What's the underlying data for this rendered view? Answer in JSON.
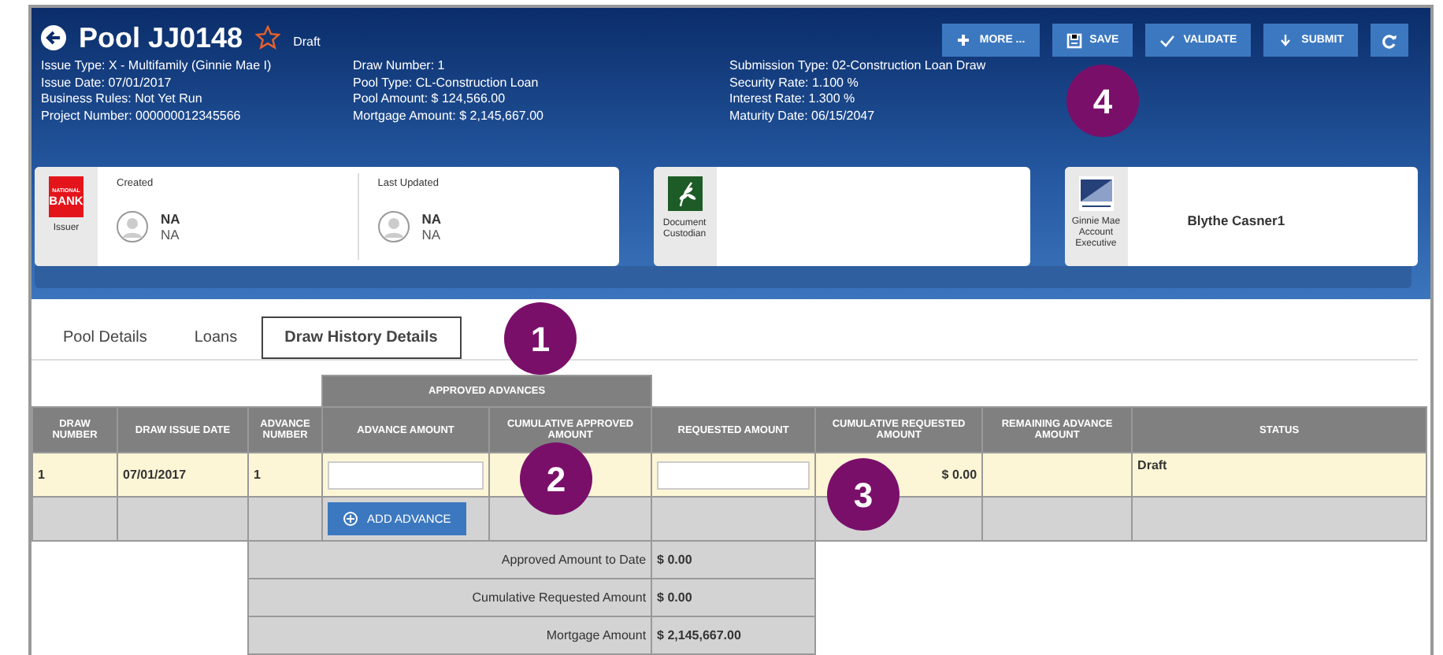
{
  "header": {
    "title": "Pool JJ0148",
    "starred": false,
    "status": "Draft",
    "info_columns": [
      [
        "Issue Type: X - Multifamily (Ginnie Mae I)",
        "Issue Date: 07/01/2017",
        "Business Rules: Not Yet Run",
        "Project Number: 000000012345566"
      ],
      [
        "Draw Number: 1",
        "Pool Type: CL-Construction Loan",
        "Pool Amount: $ 124,566.00",
        "Mortgage Amount: $ 2,145,667.00"
      ],
      [
        "Submission Type: 02-Construction Loan Draw",
        "Security Rate: 1.100 %",
        "Interest Rate: 1.300 %",
        "Maturity Date: 06/15/2047"
      ]
    ],
    "buttons": [
      {
        "kind": "plus",
        "label": "MORE ..."
      },
      {
        "kind": "save",
        "label": "SAVE"
      },
      {
        "kind": "check",
        "label": "VALIDATE"
      },
      {
        "kind": "down",
        "label": "SUBMIT"
      },
      {
        "kind": "refresh"
      }
    ]
  },
  "cards": [
    {
      "kind": "issuer",
      "logo_lines": [
        "NATIONAL",
        "BANK"
      ],
      "role": "Issuer",
      "people": [
        {
          "heading": "Created",
          "name": "NA",
          "detail": "NA"
        },
        {
          "heading": "Last Updated",
          "name": "NA",
          "detail": "NA"
        }
      ]
    },
    {
      "kind": "custodian",
      "role": "Document Custodian"
    },
    {
      "kind": "executive",
      "role": "Ginnie Mae Account Executive",
      "name": "Blythe Casner1"
    }
  ],
  "tabs": [
    {
      "label": "Pool Details",
      "selected": false
    },
    {
      "label": "Loans",
      "selected": false
    },
    {
      "label": "Draw History Details",
      "selected": true
    }
  ],
  "table": {
    "group_header": "APPROVED ADVANCES",
    "columns": [
      "DRAW NUMBER",
      "DRAW ISSUE DATE",
      "ADVANCE NUMBER",
      "ADVANCE AMOUNT",
      "CUMULATIVE APPROVED AMOUNT",
      "REQUESTED AMOUNT",
      "CUMULATIVE REQUESTED AMOUNT",
      "REMAINING ADVANCE AMOUNT",
      "STATUS"
    ],
    "rows": [
      {
        "highlighted": true,
        "draw_number": "1",
        "draw_issue_date": "07/01/2017",
        "advance_number": "1",
        "cumulative_requested_amount": "$ 0.00",
        "status": "Draft"
      }
    ],
    "add_button": "ADD ADVANCE",
    "summary": [
      {
        "label": "Approved Amount to Date",
        "value": "$ 0.00"
      },
      {
        "label": "Cumulative Requested Amount",
        "value": "$ 0.00"
      },
      {
        "label": "Mortgage Amount",
        "value": "$ 2,145,667.00"
      }
    ]
  },
  "callouts": [
    "1",
    "2",
    "3",
    "4"
  ]
}
